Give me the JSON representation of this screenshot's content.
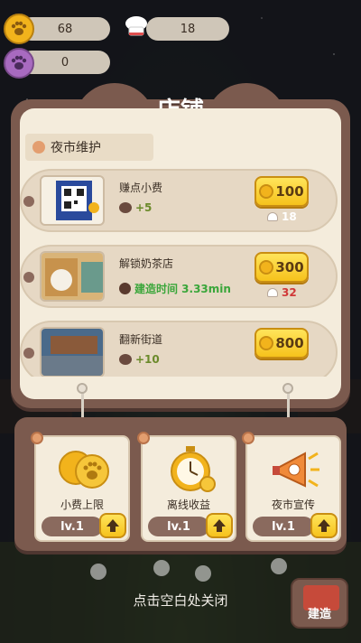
{
  "resources": {
    "coins": "68",
    "chefs": "18",
    "paws": "0"
  },
  "shop": {
    "title": "店铺",
    "section_label": "夜市维护",
    "items": [
      {
        "name": "赚点小费",
        "gain": "+5",
        "price": "100",
        "cost2": "18"
      },
      {
        "name": "解锁奶茶店",
        "time": "建造时间 3.33min",
        "price": "300",
        "cost2": "32"
      },
      {
        "name": "翻新街道",
        "gain": "+10",
        "price": "800"
      }
    ]
  },
  "upgrades": [
    {
      "label": "小费上限",
      "level": "lv.1"
    },
    {
      "label": "离线收益",
      "level": "lv.1"
    },
    {
      "label": "夜市宣传",
      "level": "lv.1"
    }
  ],
  "close_hint": "点击空白处关闭",
  "build_button": "建造",
  "colors": {
    "frame": "#7b5a4e",
    "cream": "#f4ecdc",
    "gold_button": "#f6c21c",
    "cost_red": "#d03838",
    "time_green": "#3aa63a"
  }
}
